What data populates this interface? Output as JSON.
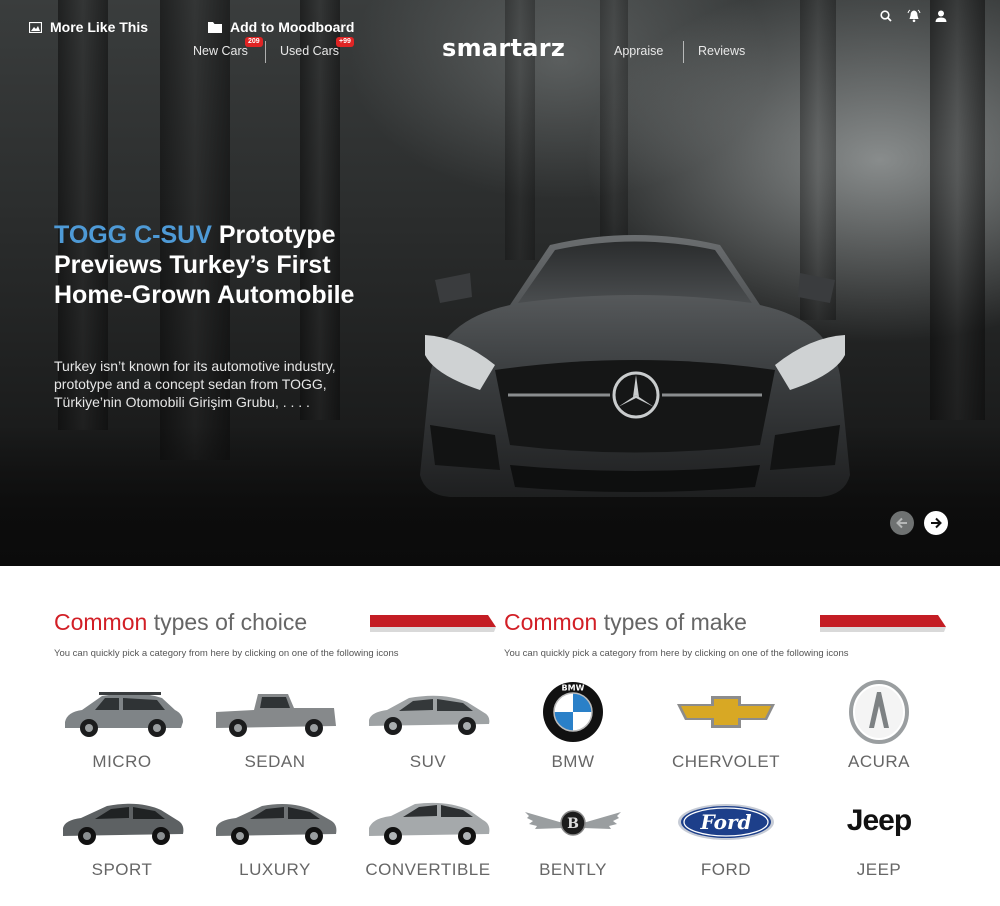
{
  "topbar": {
    "more_like_this": "More Like This",
    "add_to_moodboard": "Add to Moodboard"
  },
  "nav": {
    "new_cars": "New Cars",
    "new_cars_badge": "209",
    "used_cars": "Used Cars",
    "used_cars_badge": "+99",
    "appraise": "Appraise",
    "reviews": "Reviews"
  },
  "brand": {
    "logo": "smartarz"
  },
  "hero": {
    "title_accent": "TOGG C-SUV",
    "title_rest": " Prototype Previews Turkey’s First Home-Grown Automobile",
    "description": "Turkey isn’t known for its automotive industry,  prototype and a concept sedan from TOGG, Türkiye’nin Otomobili Girişim Grubu,  . . . ."
  },
  "choice": {
    "title_red": "Common",
    "title_rest": " types of choice",
    "subtitle": "You can quickly pick a category from here by clicking on one of the following icons",
    "items": [
      {
        "label": "MICRO"
      },
      {
        "label": "SEDAN"
      },
      {
        "label": "SUV"
      },
      {
        "label": "SPORT"
      },
      {
        "label": "LUXURY"
      },
      {
        "label": "CONVERTIBLE"
      }
    ]
  },
  "make": {
    "title_red": "Common",
    "title_rest": " types of make",
    "subtitle": "You can quickly pick a category from here by clicking on one of the following icons",
    "items": [
      {
        "label": "BMW",
        "logo_text": "BMW"
      },
      {
        "label": "CHERVOLET"
      },
      {
        "label": "ACURA"
      },
      {
        "label": "BENTLY",
        "logo_text": "B"
      },
      {
        "label": "FORD",
        "logo_text": "Ford"
      },
      {
        "label": "JEEP",
        "logo_text": "Jeep"
      }
    ]
  },
  "colors": {
    "accent_blue": "#4e9ad6",
    "accent_red": "#d21f26",
    "badge_red": "#e02424"
  },
  "icons": [
    "image-icon",
    "folder-icon",
    "search-icon",
    "bell-icon",
    "user-icon",
    "arrow-left-icon",
    "arrow-right-icon"
  ]
}
